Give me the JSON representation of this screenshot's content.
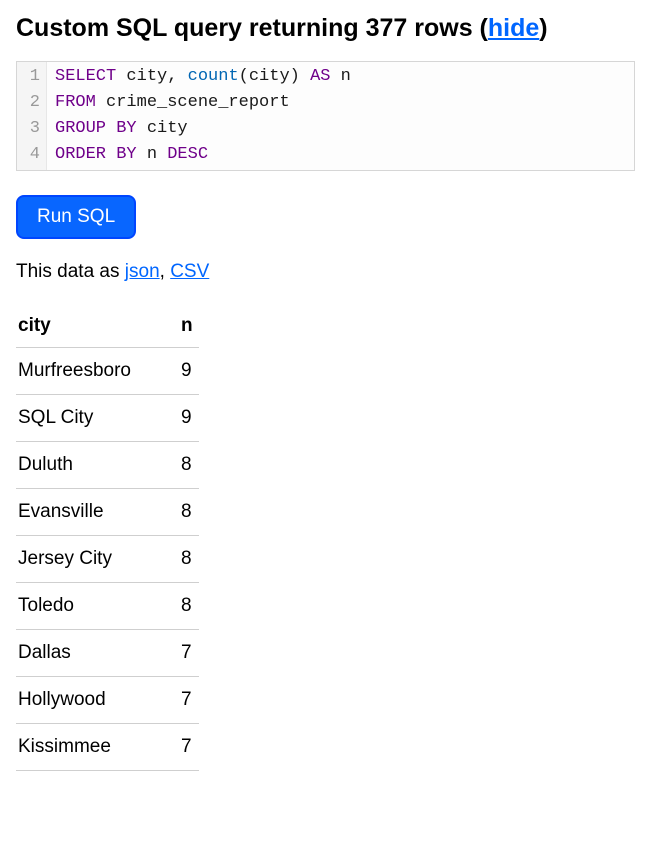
{
  "heading": {
    "prefix": "Custom SQL query returning ",
    "row_count": "377",
    "suffix": " rows (",
    "hide_label": "hide",
    "end": ")"
  },
  "sql": {
    "lines": [
      {
        "num": "1",
        "tokens": [
          {
            "t": "SELECT",
            "c": "kw"
          },
          {
            "t": " city",
            "c": "id"
          },
          {
            "t": ",",
            "c": "id"
          },
          {
            "t": " ",
            "c": "id"
          },
          {
            "t": "count",
            "c": "fn"
          },
          {
            "t": "(city)",
            "c": "id"
          },
          {
            "t": " ",
            "c": "id"
          },
          {
            "t": "AS",
            "c": "kw"
          },
          {
            "t": " n",
            "c": "id"
          }
        ]
      },
      {
        "num": "2",
        "tokens": [
          {
            "t": "FROM",
            "c": "kw"
          },
          {
            "t": " crime_scene_report",
            "c": "id"
          }
        ]
      },
      {
        "num": "3",
        "tokens": [
          {
            "t": "GROUP",
            "c": "kw"
          },
          {
            "t": " ",
            "c": "id"
          },
          {
            "t": "BY",
            "c": "kw"
          },
          {
            "t": " city",
            "c": "id"
          }
        ]
      },
      {
        "num": "4",
        "tokens": [
          {
            "t": "ORDER",
            "c": "kw"
          },
          {
            "t": " ",
            "c": "id"
          },
          {
            "t": "BY",
            "c": "kw"
          },
          {
            "t": " n ",
            "c": "id"
          },
          {
            "t": "DESC",
            "c": "kw"
          }
        ]
      }
    ]
  },
  "run_button": "Run SQL",
  "export": {
    "prefix": "This data as ",
    "json_label": "json",
    "sep": ", ",
    "csv_label": "CSV"
  },
  "table": {
    "headers": [
      "city",
      "n"
    ],
    "rows": [
      [
        "Murfreesboro",
        "9"
      ],
      [
        "SQL City",
        "9"
      ],
      [
        "Duluth",
        "8"
      ],
      [
        "Evansville",
        "8"
      ],
      [
        "Jersey City",
        "8"
      ],
      [
        "Toledo",
        "8"
      ],
      [
        "Dallas",
        "7"
      ],
      [
        "Hollywood",
        "7"
      ],
      [
        "Kissimmee",
        "7"
      ]
    ]
  }
}
